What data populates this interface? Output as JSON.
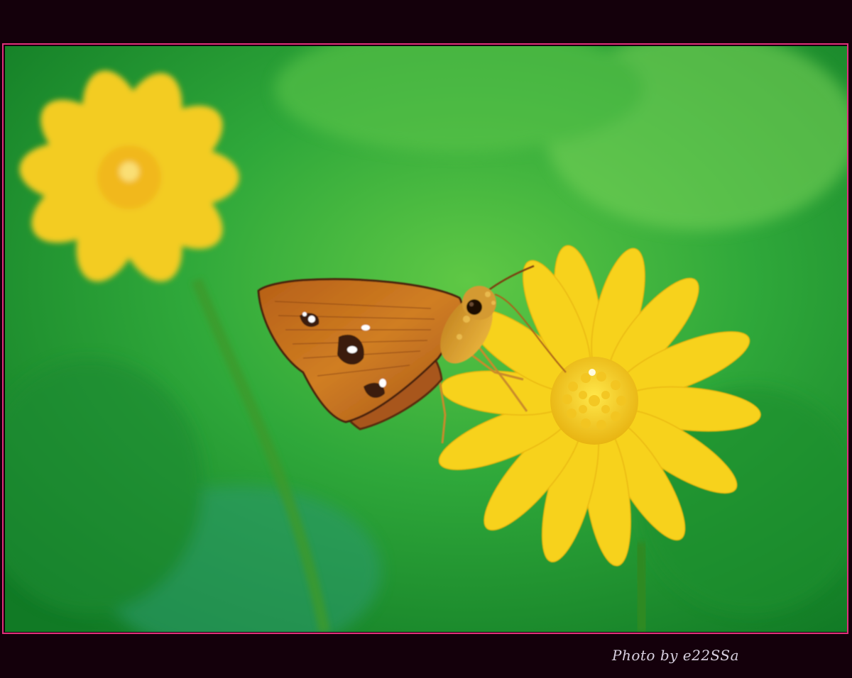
{
  "image": {
    "subject": "skipper-butterfly-on-yellow-daisy",
    "credit_text": "Photo by e22SSa"
  },
  "colors": {
    "outer_background": "#14000b",
    "frame_line": "#e0307a",
    "foliage_green": "#2fa83a",
    "petal_yellow": "#f7d21a",
    "wing_orange": "#c8741a",
    "credit_text": "#d8d0e0"
  }
}
